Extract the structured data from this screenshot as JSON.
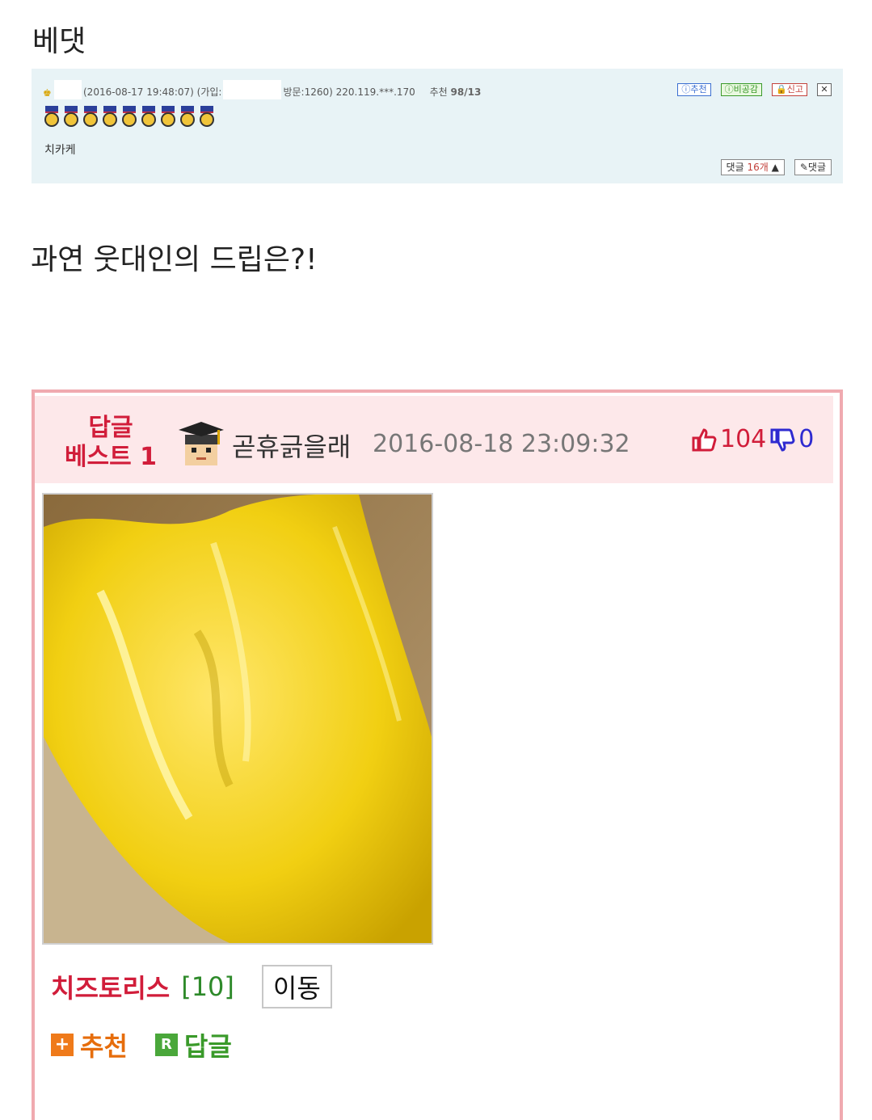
{
  "page": {
    "title": "베댓",
    "question": "과연 웃대인의 드립은?!"
  },
  "embedded_comment": {
    "date_text": "(2016-08-17 19:48:07)",
    "join_label": "(가입:",
    "visits_text": "방문:1260)",
    "ip_text": "220.119.***.170",
    "recommend_label": "추천",
    "recommend_value": "98/13",
    "nickname": "치카케",
    "buttons": {
      "recommend": "ⓘ추천",
      "disapprove": "ⓘ비공감",
      "report": "신고",
      "close": "✕"
    },
    "reply_count_label": "댓글",
    "reply_count_value": "16개",
    "reply_arrow": "▲",
    "write_reply": "댓글",
    "medal_count": 9
  },
  "best_reply": {
    "label_line1": "답글",
    "label_line2": "베스트 1",
    "author": "곧휴긁을래",
    "timestamp": "2016-08-18 23:09:32",
    "upvotes": "104",
    "downvotes": "0",
    "tag_name": "치즈토리스",
    "tag_count": "[10]",
    "move_button": "이동",
    "action_recommend": "추천",
    "action_reply": "답글",
    "icon_plus": "+",
    "icon_r": "R"
  },
  "colors": {
    "accent_red": "#d11d3a",
    "accent_green": "#3a9a2a",
    "accent_orange": "#e66d0c",
    "card_border": "#f0aab0",
    "card_header_bg": "#fde8ea",
    "embed_bg": "#e8f3f6"
  },
  "icons": [
    "rank-icon",
    "medal-icon",
    "avatar",
    "thumb-up-icon",
    "thumb-down-icon",
    "plus-icon",
    "reply-icon",
    "close-icon",
    "pencil-icon"
  ]
}
